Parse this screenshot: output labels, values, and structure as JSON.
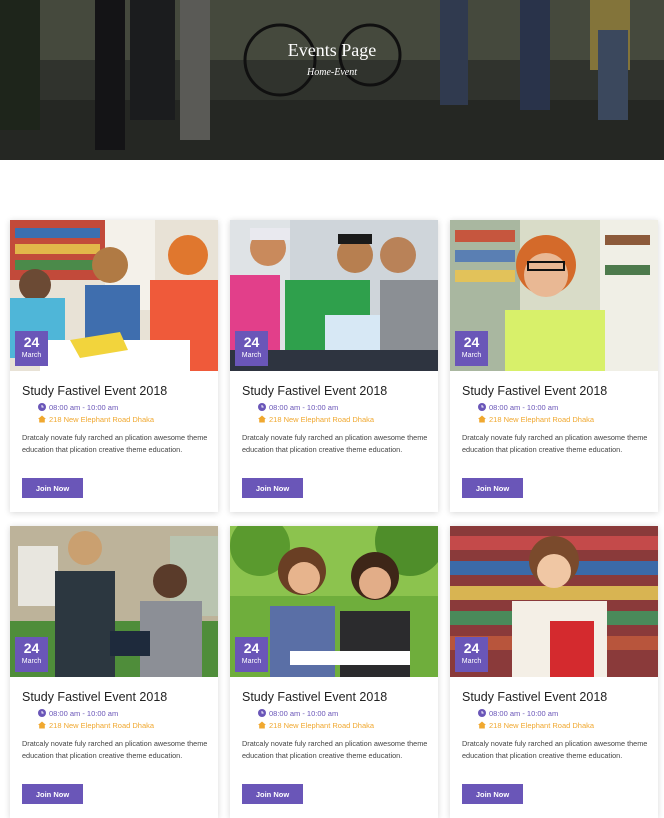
{
  "hero": {
    "title": "Events Page",
    "breadcrumb": "Home-Event"
  },
  "events": [
    {
      "day": "24",
      "month": "March",
      "title": "Study Fastivel Event 2018",
      "time": "08:00 am - 10:00 am",
      "location": "218 New Elephant Road Dhaka",
      "description": "Dratcaly novate fuly rarched an plication awesome theme education that plication creative theme education.",
      "button": "Join Now"
    },
    {
      "day": "24",
      "month": "March",
      "title": "Study Fastivel Event 2018",
      "time": "08:00 am - 10:00 am",
      "location": "218 New Elephant Road Dhaka",
      "description": "Dratcaly novate fuly rarched an plication awesome theme education that plication creative theme education.",
      "button": "Join Now"
    },
    {
      "day": "24",
      "month": "March",
      "title": "Study Fastivel Event 2018",
      "time": "08:00 am - 10:00 am",
      "location": "218 New Elephant Road Dhaka",
      "description": "Dratcaly novate fuly rarched an plication awesome theme education that plication creative theme education.",
      "button": "Join Now"
    },
    {
      "day": "24",
      "month": "March",
      "title": "Study Fastivel Event 2018",
      "time": "08:00 am - 10:00 am",
      "location": "218 New Elephant Road Dhaka",
      "description": "Dratcaly novate fuly rarched an plication awesome theme education that plication creative theme education.",
      "button": "Join Now"
    },
    {
      "day": "24",
      "month": "March",
      "title": "Study Fastivel Event 2018",
      "time": "08:00 am - 10:00 am",
      "location": "218 New Elephant Road Dhaka",
      "description": "Dratcaly novate fuly rarched an plication awesome theme education that plication creative theme education.",
      "button": "Join Now"
    },
    {
      "day": "24",
      "month": "March",
      "title": "Study Fastivel Event 2018",
      "time": "08:00 am - 10:00 am",
      "location": "218 New Elephant Road Dhaka",
      "description": "Dratcaly novate fuly rarched an plication awesome theme education that plication creative theme education.",
      "button": "Join Now"
    }
  ],
  "icons": {
    "time": "clock-icon",
    "location": "home-icon"
  },
  "colors": {
    "accent": "#6a56b8",
    "location": "#f0a830"
  }
}
